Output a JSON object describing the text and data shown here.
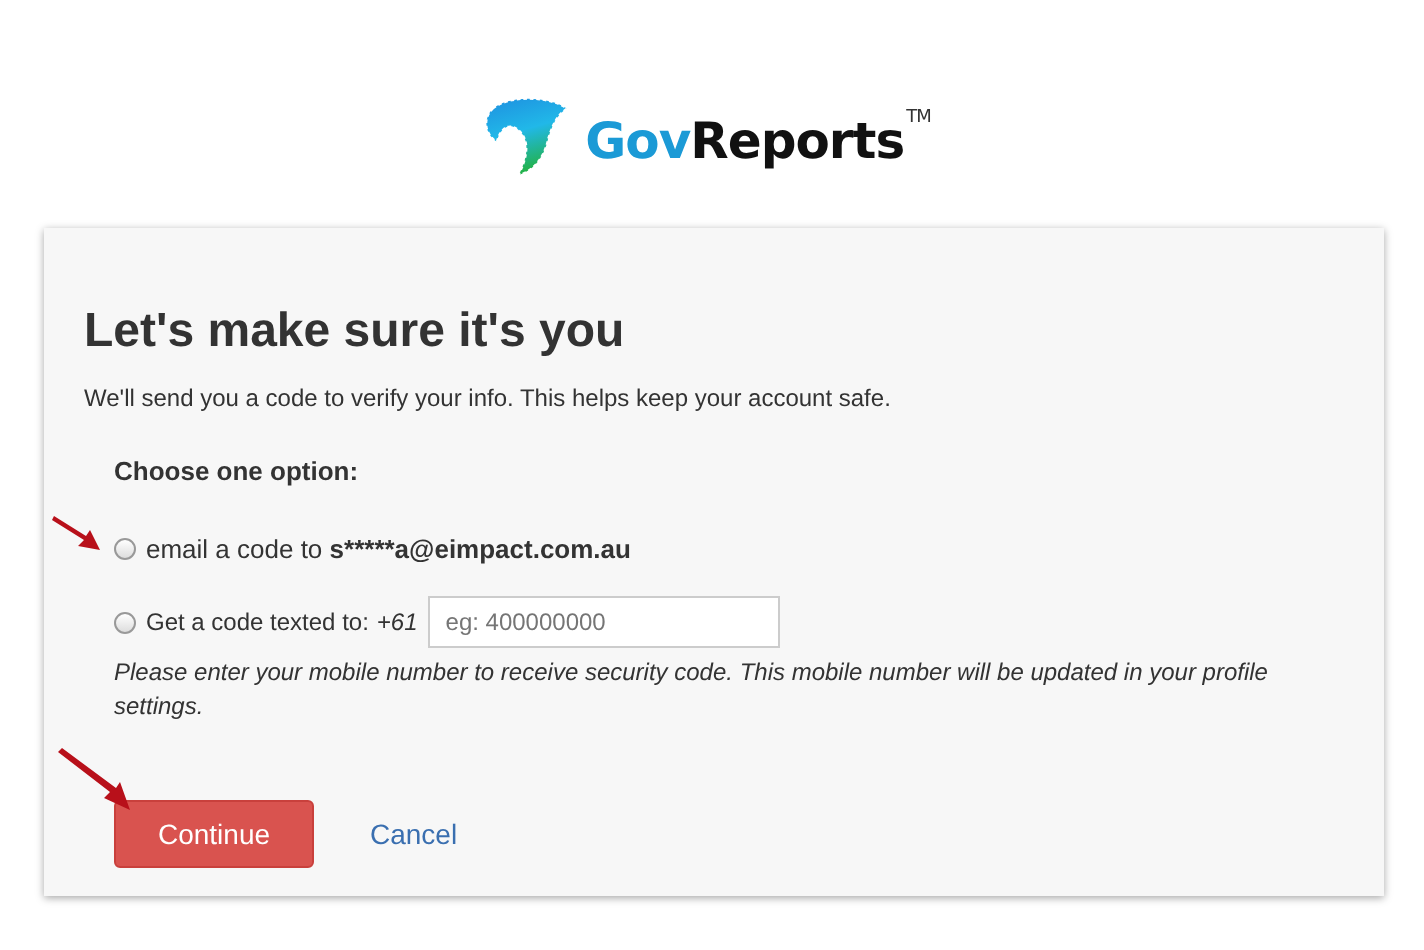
{
  "logo": {
    "prefix": "Gov",
    "name": "Reports",
    "mark": "TM"
  },
  "card": {
    "title": "Let's make sure it's you",
    "subtitle": "We'll send you a code to verify your info. This helps keep your account safe.",
    "options_label": "Choose one option:",
    "options": [
      {
        "kind": "email",
        "label": "email a code to",
        "address": "s*****a@eimpact.com.au",
        "selected": false
      },
      {
        "kind": "phone",
        "label": "Get a code texted to:",
        "prefix": "+61",
        "placeholder": "eg: 400000000",
        "selected": false
      }
    ],
    "note": "Please enter your mobile number to receive security code. This mobile number will be updated in your profile settings.",
    "continue": "Continue",
    "cancel": "Cancel"
  }
}
